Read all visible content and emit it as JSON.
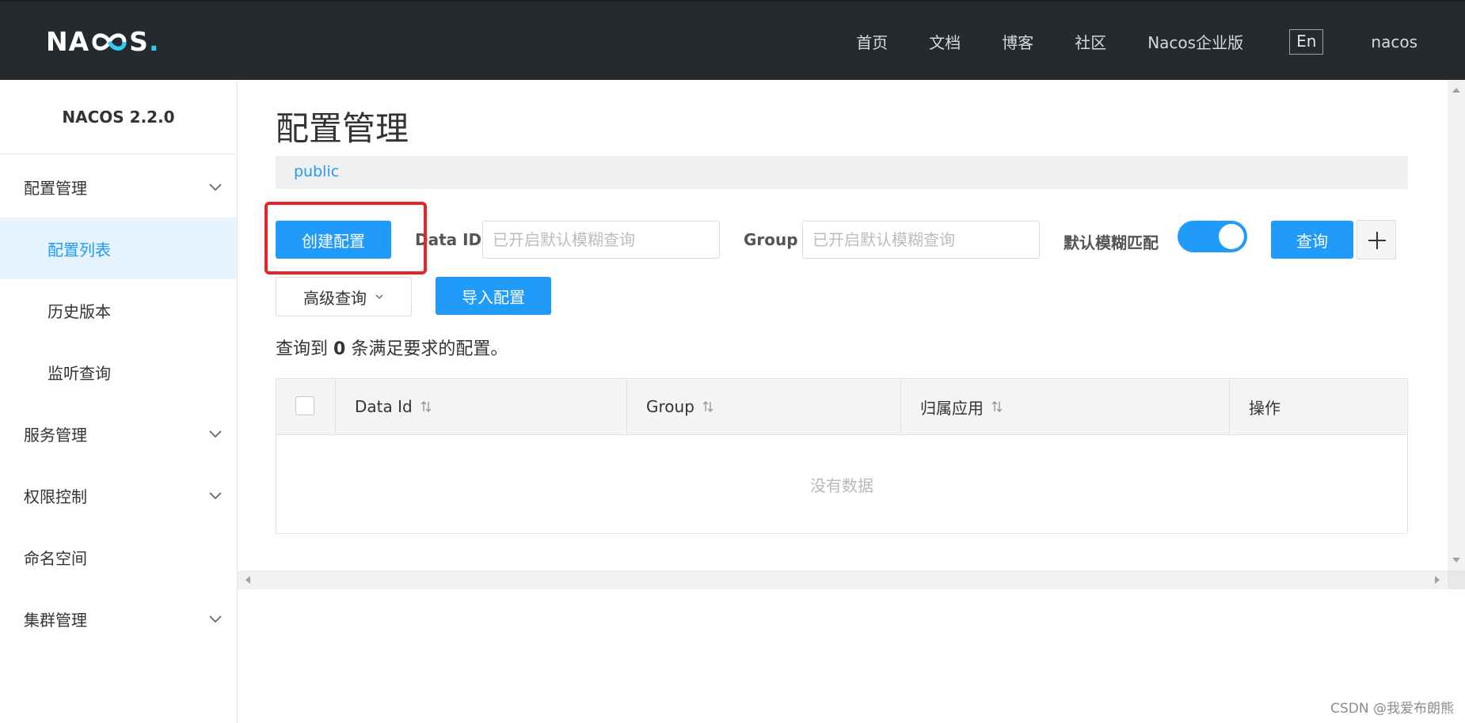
{
  "header": {
    "logo_text": "NACOS",
    "nav": [
      "首页",
      "文档",
      "博客",
      "社区",
      "Nacos企业版"
    ],
    "lang": "En",
    "user": "nacos"
  },
  "sidebar": {
    "title": "NACOS 2.2.0",
    "items": [
      {
        "label": "配置管理",
        "type": "group"
      },
      {
        "label": "配置列表",
        "type": "sub",
        "active": true
      },
      {
        "label": "历史版本",
        "type": "sub"
      },
      {
        "label": "监听查询",
        "type": "sub"
      },
      {
        "label": "服务管理",
        "type": "group"
      },
      {
        "label": "权限控制",
        "type": "group"
      },
      {
        "label": "命名空间",
        "type": "item"
      },
      {
        "label": "集群管理",
        "type": "group"
      }
    ]
  },
  "main": {
    "title": "配置管理",
    "namespace": "public",
    "create_button": "创建配置",
    "data_id_label": "Data ID",
    "data_id_placeholder": "已开启默认模糊查询",
    "group_label": "Group",
    "group_placeholder": "已开启默认模糊查询",
    "fuzzy_label": "默认模糊匹配",
    "fuzzy_enabled": true,
    "search_button": "查询",
    "advanced_button": "高级查询",
    "import_button": "导入配置",
    "result_prefix": "查询到",
    "result_count": "0",
    "result_suffix": "条满足要求的配置。",
    "table": {
      "columns": [
        "Data Id",
        "Group",
        "归属应用",
        "操作"
      ],
      "empty_text": "没有数据"
    }
  },
  "watermark": "CSDN @我爱布朗熊",
  "colors": {
    "primary": "#209bfa",
    "header_bg": "#252a2f",
    "active_bg": "#e5f3ff",
    "highlight": "#e6252b"
  }
}
